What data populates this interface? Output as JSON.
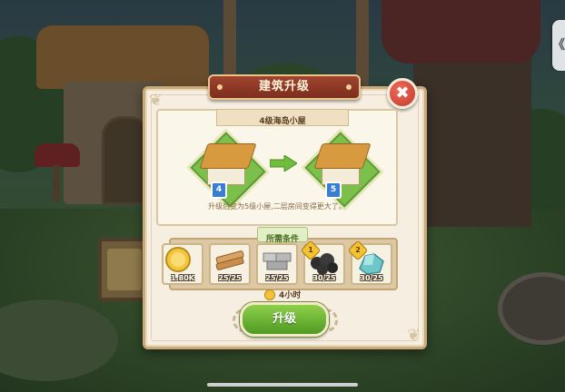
{
  "dialog": {
    "title": "建筑升级",
    "close_glyph": "✖"
  },
  "house": {
    "name": "4级海岛小屋",
    "current_level": "4",
    "next_level": "5",
    "description": "升级后变为5级小屋,二层房间变得更大了。"
  },
  "requirements": {
    "label": "所需条件",
    "items": [
      {
        "icon": "gold-coin-icon",
        "amount": "1.80K"
      },
      {
        "icon": "wood-planks-icon",
        "amount": "25/25"
      },
      {
        "icon": "stone-bricks-icon",
        "amount": "25/25"
      },
      {
        "icon": "coal-ore-icon",
        "amount": "30/25",
        "badge": "1"
      },
      {
        "icon": "crystal-ore-icon",
        "amount": "30/25",
        "badge": "2"
      }
    ]
  },
  "time": {
    "label": "4小时"
  },
  "upgrade_button": {
    "label": "升级"
  },
  "side_tab": {
    "glyph": "《"
  },
  "colors": {
    "title_banner": "#8a3624",
    "close_button": "#d8483a",
    "upgrade_button": "#6db535",
    "panel": "#f6efe1",
    "level_badge": "#3a7ed4"
  }
}
